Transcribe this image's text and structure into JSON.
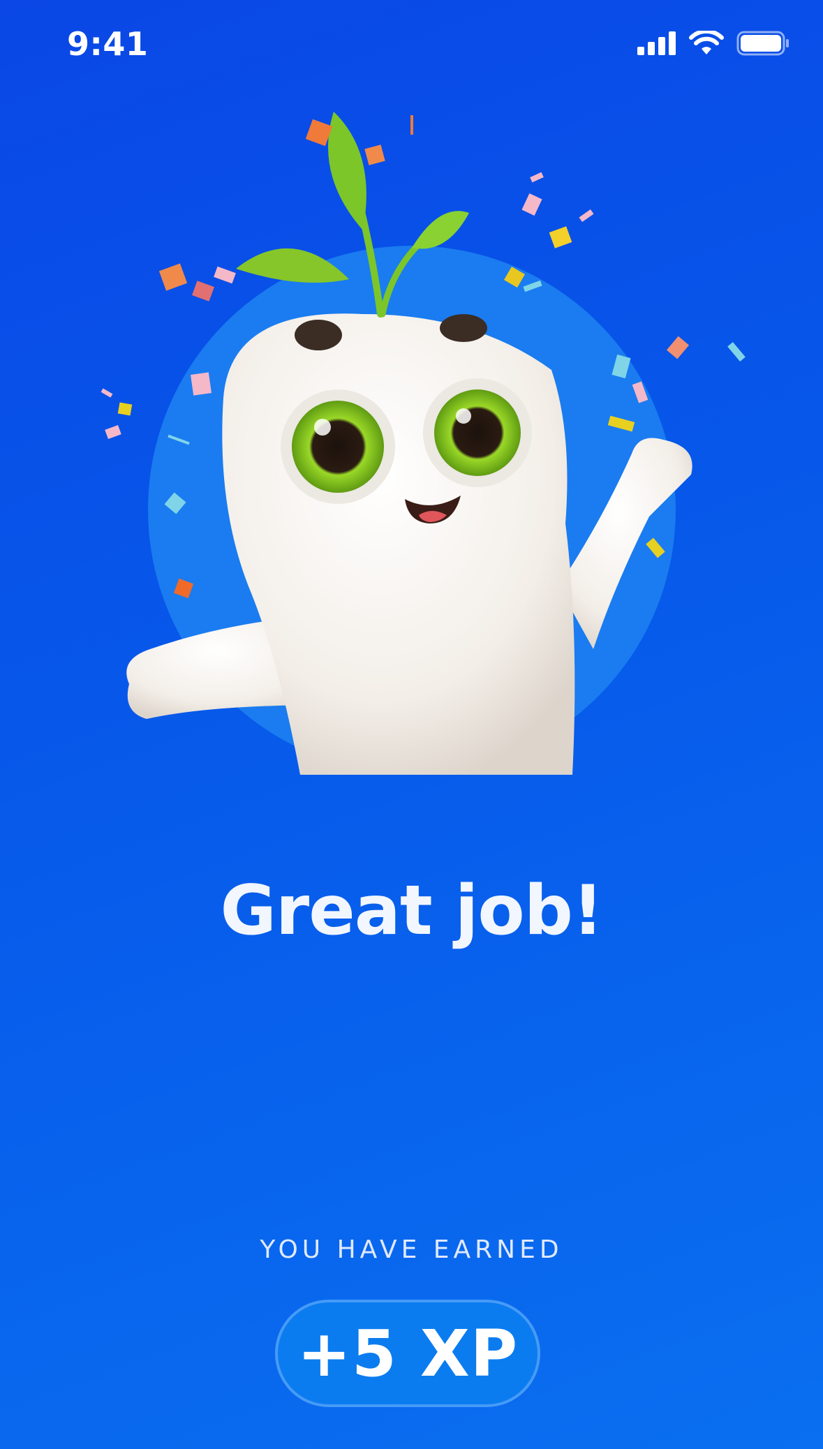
{
  "status_bar": {
    "time": "9:41",
    "icons": [
      "cellular-signal-icon",
      "wifi-icon",
      "battery-icon"
    ]
  },
  "hero": {
    "illustration": "mascot-with-sprout-and-confetti",
    "circle_color": "#1a7cf0"
  },
  "main": {
    "title": "Great job!",
    "earned_label": "YOU HAVE EARNED",
    "xp_value": "+5 XP"
  },
  "colors": {
    "background_top": "#0a47e6",
    "background_bottom": "#0a6ff0",
    "pill": "#0b7cef",
    "leaf": "#7cc62a",
    "eye": "#8cd21f"
  }
}
